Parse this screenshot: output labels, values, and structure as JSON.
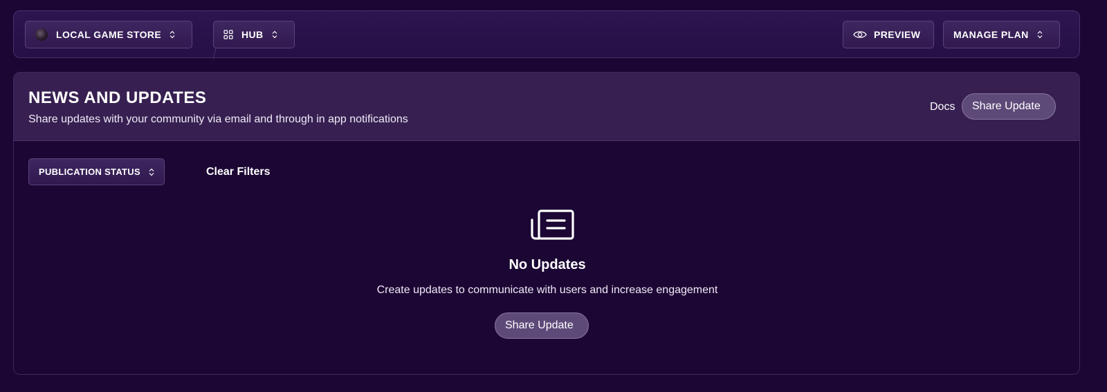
{
  "topbar": {
    "store_label": "LOCAL GAME STORE",
    "hub_label": "HUB",
    "preview_label": "PREVIEW",
    "manage_plan_label": "MANAGE PLAN"
  },
  "header": {
    "title": "NEWS AND UPDATES",
    "subtitle": "Share updates with your community via email and through in app notifications",
    "docs_label": "Docs",
    "share_update_label": "Share Update"
  },
  "filters": {
    "publication_status_label": "PUBLICATION STATUS",
    "clear_filters_label": "Clear Filters"
  },
  "empty_state": {
    "icon": "newspaper-icon",
    "title": "No Updates",
    "text": "Create updates to communicate with users and increase engagement",
    "button_label": "Share Update"
  },
  "colors": {
    "background": "#1c0634",
    "header_bg": "#372051",
    "button_bg": "#5e4a79"
  }
}
